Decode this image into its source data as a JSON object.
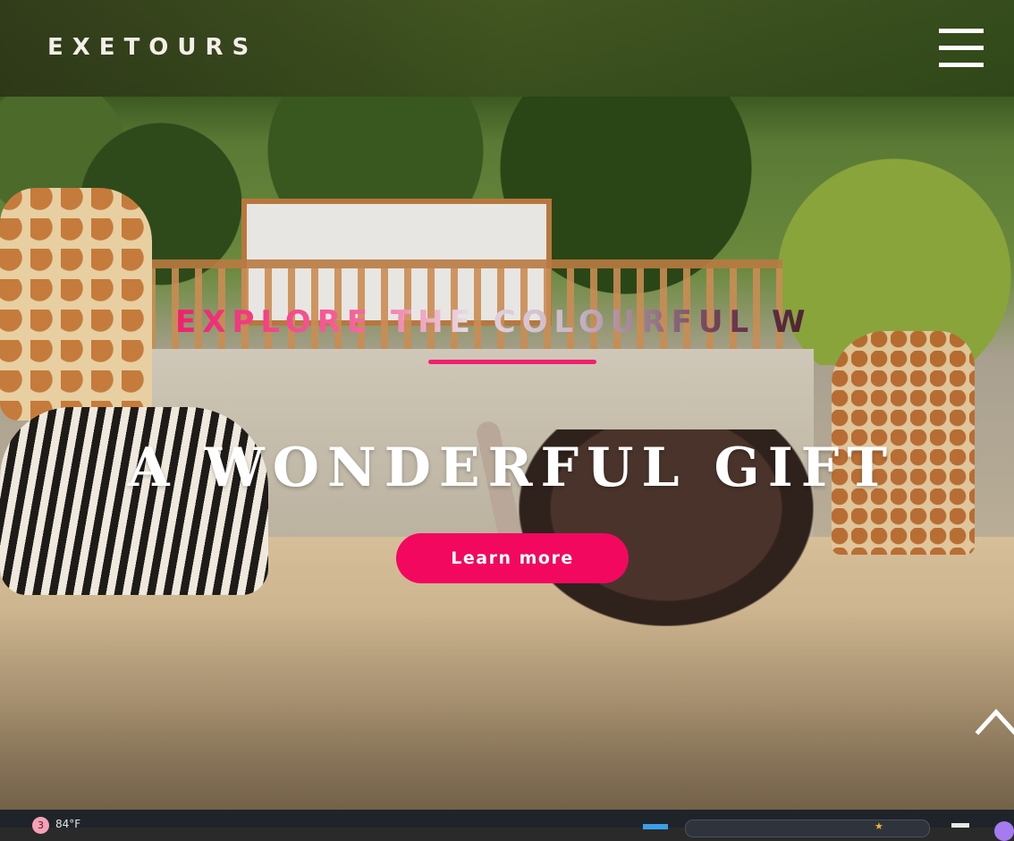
{
  "header": {
    "logo_text": "EXETOURS",
    "menu_icon": "hamburger-menu-icon"
  },
  "hero": {
    "tagline": "EXPLORE THE COLOURFUL W",
    "headline": "A WONDERFUL GIFT",
    "cta_label": "Learn more",
    "accent_color": "#f2085f",
    "scroll_top_icon": "chevron-up-icon"
  },
  "taskbar": {
    "weather_badge": "3",
    "temperature": "84°F",
    "start_icon": "windows-start-icon",
    "search_icon": "search-icon"
  }
}
